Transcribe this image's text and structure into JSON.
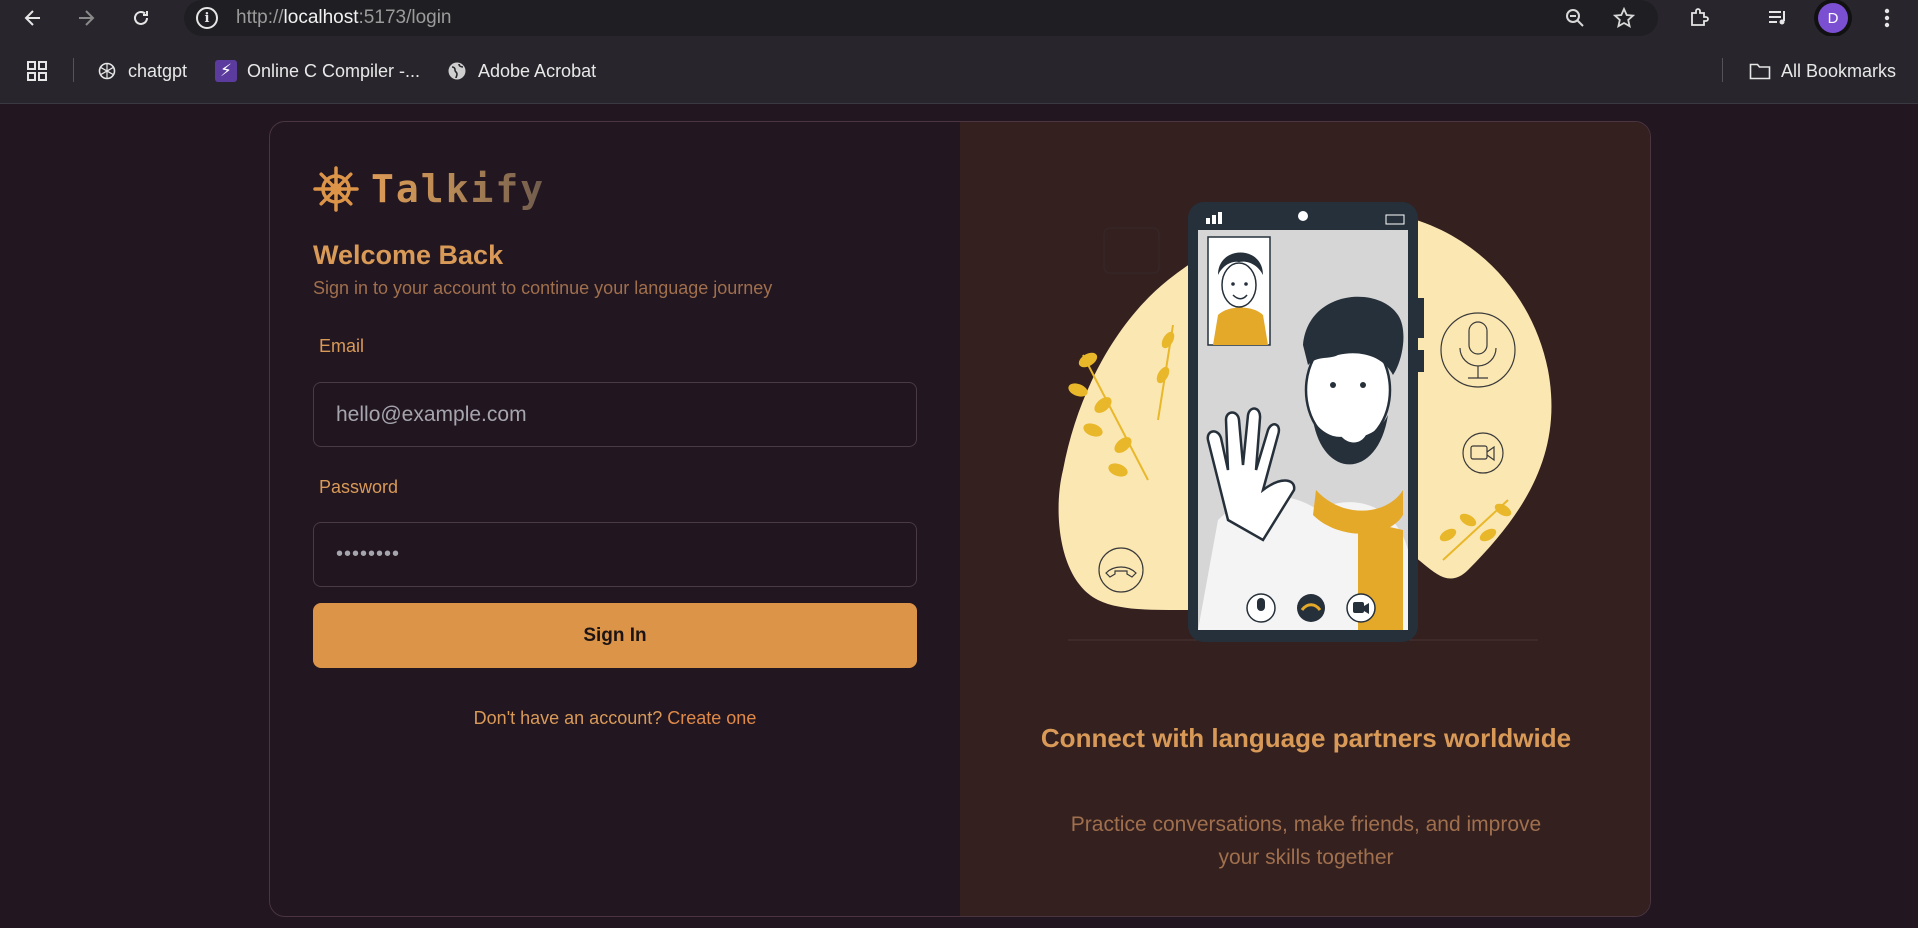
{
  "browser": {
    "url_scheme": "http://",
    "url_host": "localhost",
    "url_path": ":5173/login",
    "profile_initial": "D",
    "bookmarks": [
      {
        "label": "chatgpt",
        "icon": "chatgpt-icon"
      },
      {
        "label": "Online C Compiler -...",
        "icon": "bolt-icon"
      },
      {
        "label": "Adobe Acrobat",
        "icon": "globe-icon"
      }
    ],
    "all_bookmarks_label": "All Bookmarks"
  },
  "brand": {
    "name": "Talkify",
    "icon": "ship-wheel-icon",
    "accent": "#dc9448"
  },
  "login": {
    "title": "Welcome Back",
    "subtitle": "Sign in to your account to continue your language journey",
    "email_label": "Email",
    "email_placeholder": "hello@example.com",
    "password_label": "Password",
    "password_value": "••••••••",
    "submit_label": "Sign In",
    "signup_prompt": "Don't have an account?",
    "signup_link": "Create one"
  },
  "promo": {
    "title": "Connect with language partners worldwide",
    "description": "Practice conversations, make friends, and improve your skills together"
  }
}
